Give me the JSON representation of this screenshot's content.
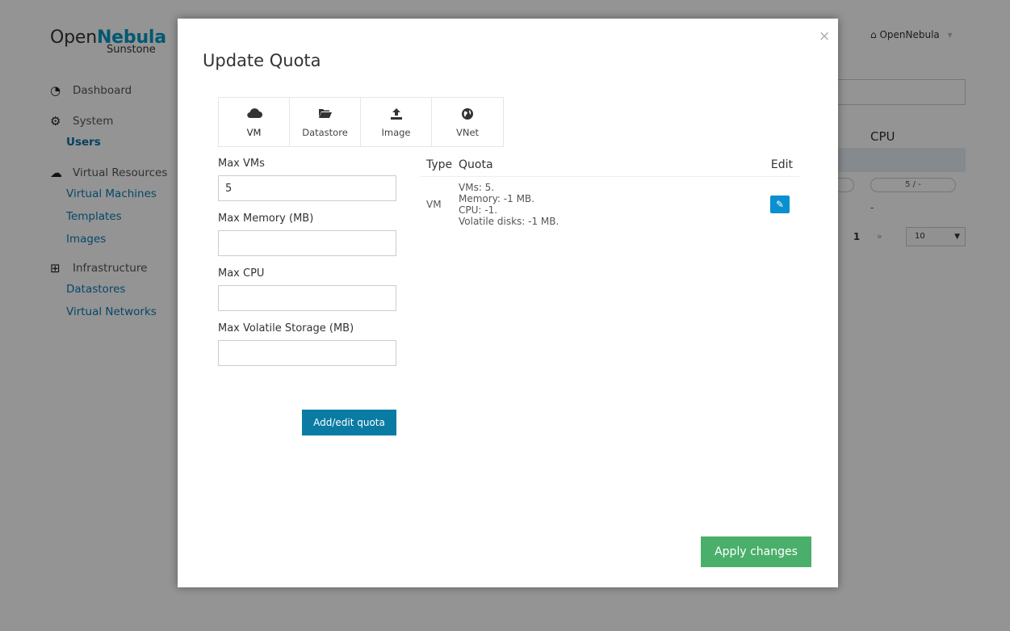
{
  "app": {
    "logo_open": "Open",
    "logo_nebula": "Nebula",
    "logo_sub": "Sunstone",
    "user_menu": "OpenNebula"
  },
  "nav": {
    "dashboard": "Dashboard",
    "system": "System",
    "users": "Users",
    "virtual_resources": "Virtual Resources",
    "virtual_machines": "Virtual Machines",
    "templates": "Templates",
    "images": "Images",
    "infrastructure": "Infrastructure",
    "datastores": "Datastores",
    "virtual_networks": "Virtual Networks"
  },
  "background": {
    "cpu_header": "CPU",
    "row_dash": "-",
    "pill_value": "5 / -",
    "dash2": "-",
    "page_number": "1",
    "next_glyph": "»",
    "page_size": "10"
  },
  "modal": {
    "title": "Update Quota",
    "close": "×",
    "tabs": [
      {
        "label": "VM",
        "icon": "cloud-icon"
      },
      {
        "label": "Datastore",
        "icon": "folder-open-icon"
      },
      {
        "label": "Image",
        "icon": "upload-icon"
      },
      {
        "label": "VNet",
        "icon": "globe-icon"
      }
    ],
    "form": {
      "max_vms_label": "Max VMs",
      "max_vms_value": "5",
      "max_memory_label": "Max Memory (MB)",
      "max_memory_value": "",
      "max_cpu_label": "Max CPU",
      "max_cpu_value": "",
      "max_volatile_label": "Max Volatile Storage (MB)",
      "max_volatile_value": "",
      "add_button": "Add/edit quota"
    },
    "table": {
      "headers": {
        "type": "Type",
        "quota": "Quota",
        "edit": "Edit"
      },
      "rows": [
        {
          "type": "VM",
          "lines": [
            "VMs: 5.",
            "Memory: -1 MB.",
            "CPU: -1.",
            "Volatile disks: -1 MB."
          ]
        }
      ]
    },
    "apply_button": "Apply changes"
  },
  "colors": {
    "brand": "#0098c3",
    "link": "#0a7bb3",
    "primary_button": "#0a7ba3",
    "edit_button": "#0a8fd0",
    "apply_button": "#4aaf6b"
  }
}
